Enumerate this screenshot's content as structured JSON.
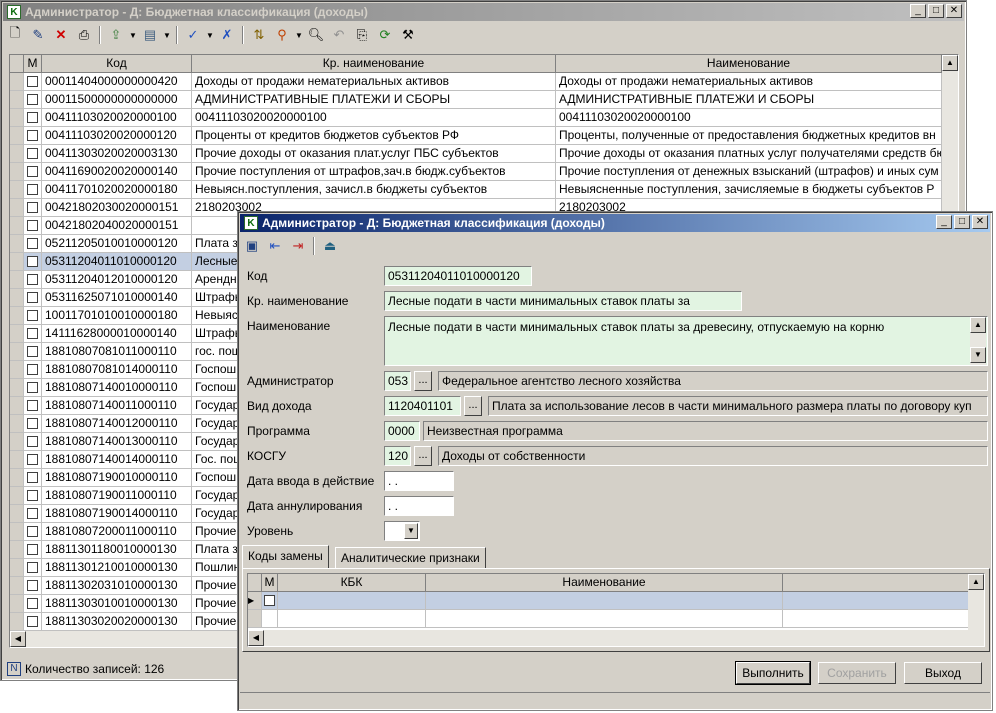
{
  "main": {
    "title": "Администратор - Д: Бюджетная классификация (доходы)",
    "columns": [
      "М",
      "Код",
      "Кр. наименование",
      "Наименование"
    ],
    "rows": [
      {
        "code": "00011404000000000420",
        "short": "Доходы от продажи нематериальных активов",
        "name": "Доходы от продажи нематериальных активов"
      },
      {
        "code": "00011500000000000000",
        "short": "АДМИНИСТРАТИВНЫЕ ПЛАТЕЖИ И СБОРЫ",
        "name": "АДМИНИСТРАТИВНЫЕ ПЛАТЕЖИ И СБОРЫ"
      },
      {
        "code": "00411103020020000100",
        "short": "00411103020020000100",
        "name": "00411103020020000100"
      },
      {
        "code": "00411103020020000120",
        "short": "Проценты от кредитов бюджетов субъектов РФ",
        "name": "Проценты, полученные от предоставления бюджетных кредитов вн"
      },
      {
        "code": "00411303020020003130",
        "short": "Прочие доходы от оказания плат.услуг ПБС субъектов",
        "name": "Прочие доходы от оказания платных услуг получателями средств бю"
      },
      {
        "code": "00411690020020000140",
        "short": "Прочие поступления от штрафов,зач.в бюдж.субъектов",
        "name": "Прочие поступления от денежных взысканий (штрафов) и иных сум"
      },
      {
        "code": "00411701020020000180",
        "short": "Невыясн.поступления, зачисл.в бюджеты субъектов",
        "name": "Невыясненные поступления, зачисляемые в бюджеты субъектов Р"
      },
      {
        "code": "00421802030020000151",
        "short": "2180203002",
        "name": "2180203002"
      },
      {
        "code": "00421802040020000151",
        "short": "",
        "name": ""
      },
      {
        "code": "05211205010010000120",
        "short": "Плата з",
        "name": ""
      },
      {
        "code": "05311204011010000120",
        "short": "Лесные",
        "name": ""
      },
      {
        "code": "05311204012010000120",
        "short": "Арендн",
        "name": ""
      },
      {
        "code": "05311625071010000140",
        "short": "Штрафь",
        "name": ""
      },
      {
        "code": "10011701010010000180",
        "short": "Невыяс",
        "name": ""
      },
      {
        "code": "14111628000010000140",
        "short": "Штрафь",
        "name": ""
      },
      {
        "code": "18810807081011000110",
        "short": "гос. пош",
        "name": ""
      },
      {
        "code": "18810807081014000110",
        "short": "Госпош",
        "name": ""
      },
      {
        "code": "18810807140010000110",
        "short": "Госпош",
        "name": ""
      },
      {
        "code": "18810807140011000110",
        "short": "Государ",
        "name": ""
      },
      {
        "code": "18810807140012000110",
        "short": "Государ",
        "name": ""
      },
      {
        "code": "18810807140013000110",
        "short": "Государ",
        "name": ""
      },
      {
        "code": "18810807140014000110",
        "short": "Гос. пош",
        "name": ""
      },
      {
        "code": "18810807190010000110",
        "short": "Госпош",
        "name": ""
      },
      {
        "code": "18810807190011000110",
        "short": "Государ",
        "name": ""
      },
      {
        "code": "18810807190014000110",
        "short": "Государ",
        "name": ""
      },
      {
        "code": "18810807200011000110",
        "short": "Прочие",
        "name": ""
      },
      {
        "code": "18811301180010000130",
        "short": "Плата з",
        "name": ""
      },
      {
        "code": "18811301210010000130",
        "short": "Пошлин",
        "name": ""
      },
      {
        "code": "18811302031010000130",
        "short": "Прочие",
        "name": ""
      },
      {
        "code": "18811303010010000130",
        "short": "Прочие",
        "name": ""
      },
      {
        "code": "18811303020020000130",
        "short": "Прочие",
        "name": ""
      }
    ],
    "selected_row": 10,
    "status_label": "Количество записей: 126"
  },
  "dialog": {
    "title": "Администратор - Д: Бюджетная классификация (доходы)",
    "labels": {
      "code": "Код",
      "short": "Кр. наименование",
      "name": "Наименование",
      "admin": "Администратор",
      "income_type": "Вид дохода",
      "program": "Программа",
      "kosgu": "КОСГУ",
      "date_start": "Дата ввода в действие",
      "date_cancel": "Дата аннулирования",
      "level": "Уровень"
    },
    "values": {
      "code": "05311204011010000120",
      "short": "Лесные подати в части минимальных ставок платы за",
      "name": "Лесные подати в части минимальных ставок платы за древесину, отпускаемую на корню",
      "admin_code": "053",
      "admin_name": "Федеральное агентство лесного хозяйства",
      "income_code": "1120401101",
      "income_name": "Плата за использование лесов в части минимального размера платы по договору куп",
      "program_code": "0000",
      "program_name": "Неизвестная программа",
      "kosgu_code": "120",
      "kosgu_name": "Доходы от собственности",
      "date_start": " .  .",
      "date_cancel": " .  .",
      "level": ""
    },
    "ellipsis": "...",
    "tabs": [
      "Коды замены",
      "Аналитические признаки"
    ],
    "subgrid_columns": [
      "М",
      "КБК",
      "Наименование"
    ],
    "buttons": {
      "execute": "Выполнить",
      "save": "Сохранить",
      "exit": "Выход"
    }
  }
}
